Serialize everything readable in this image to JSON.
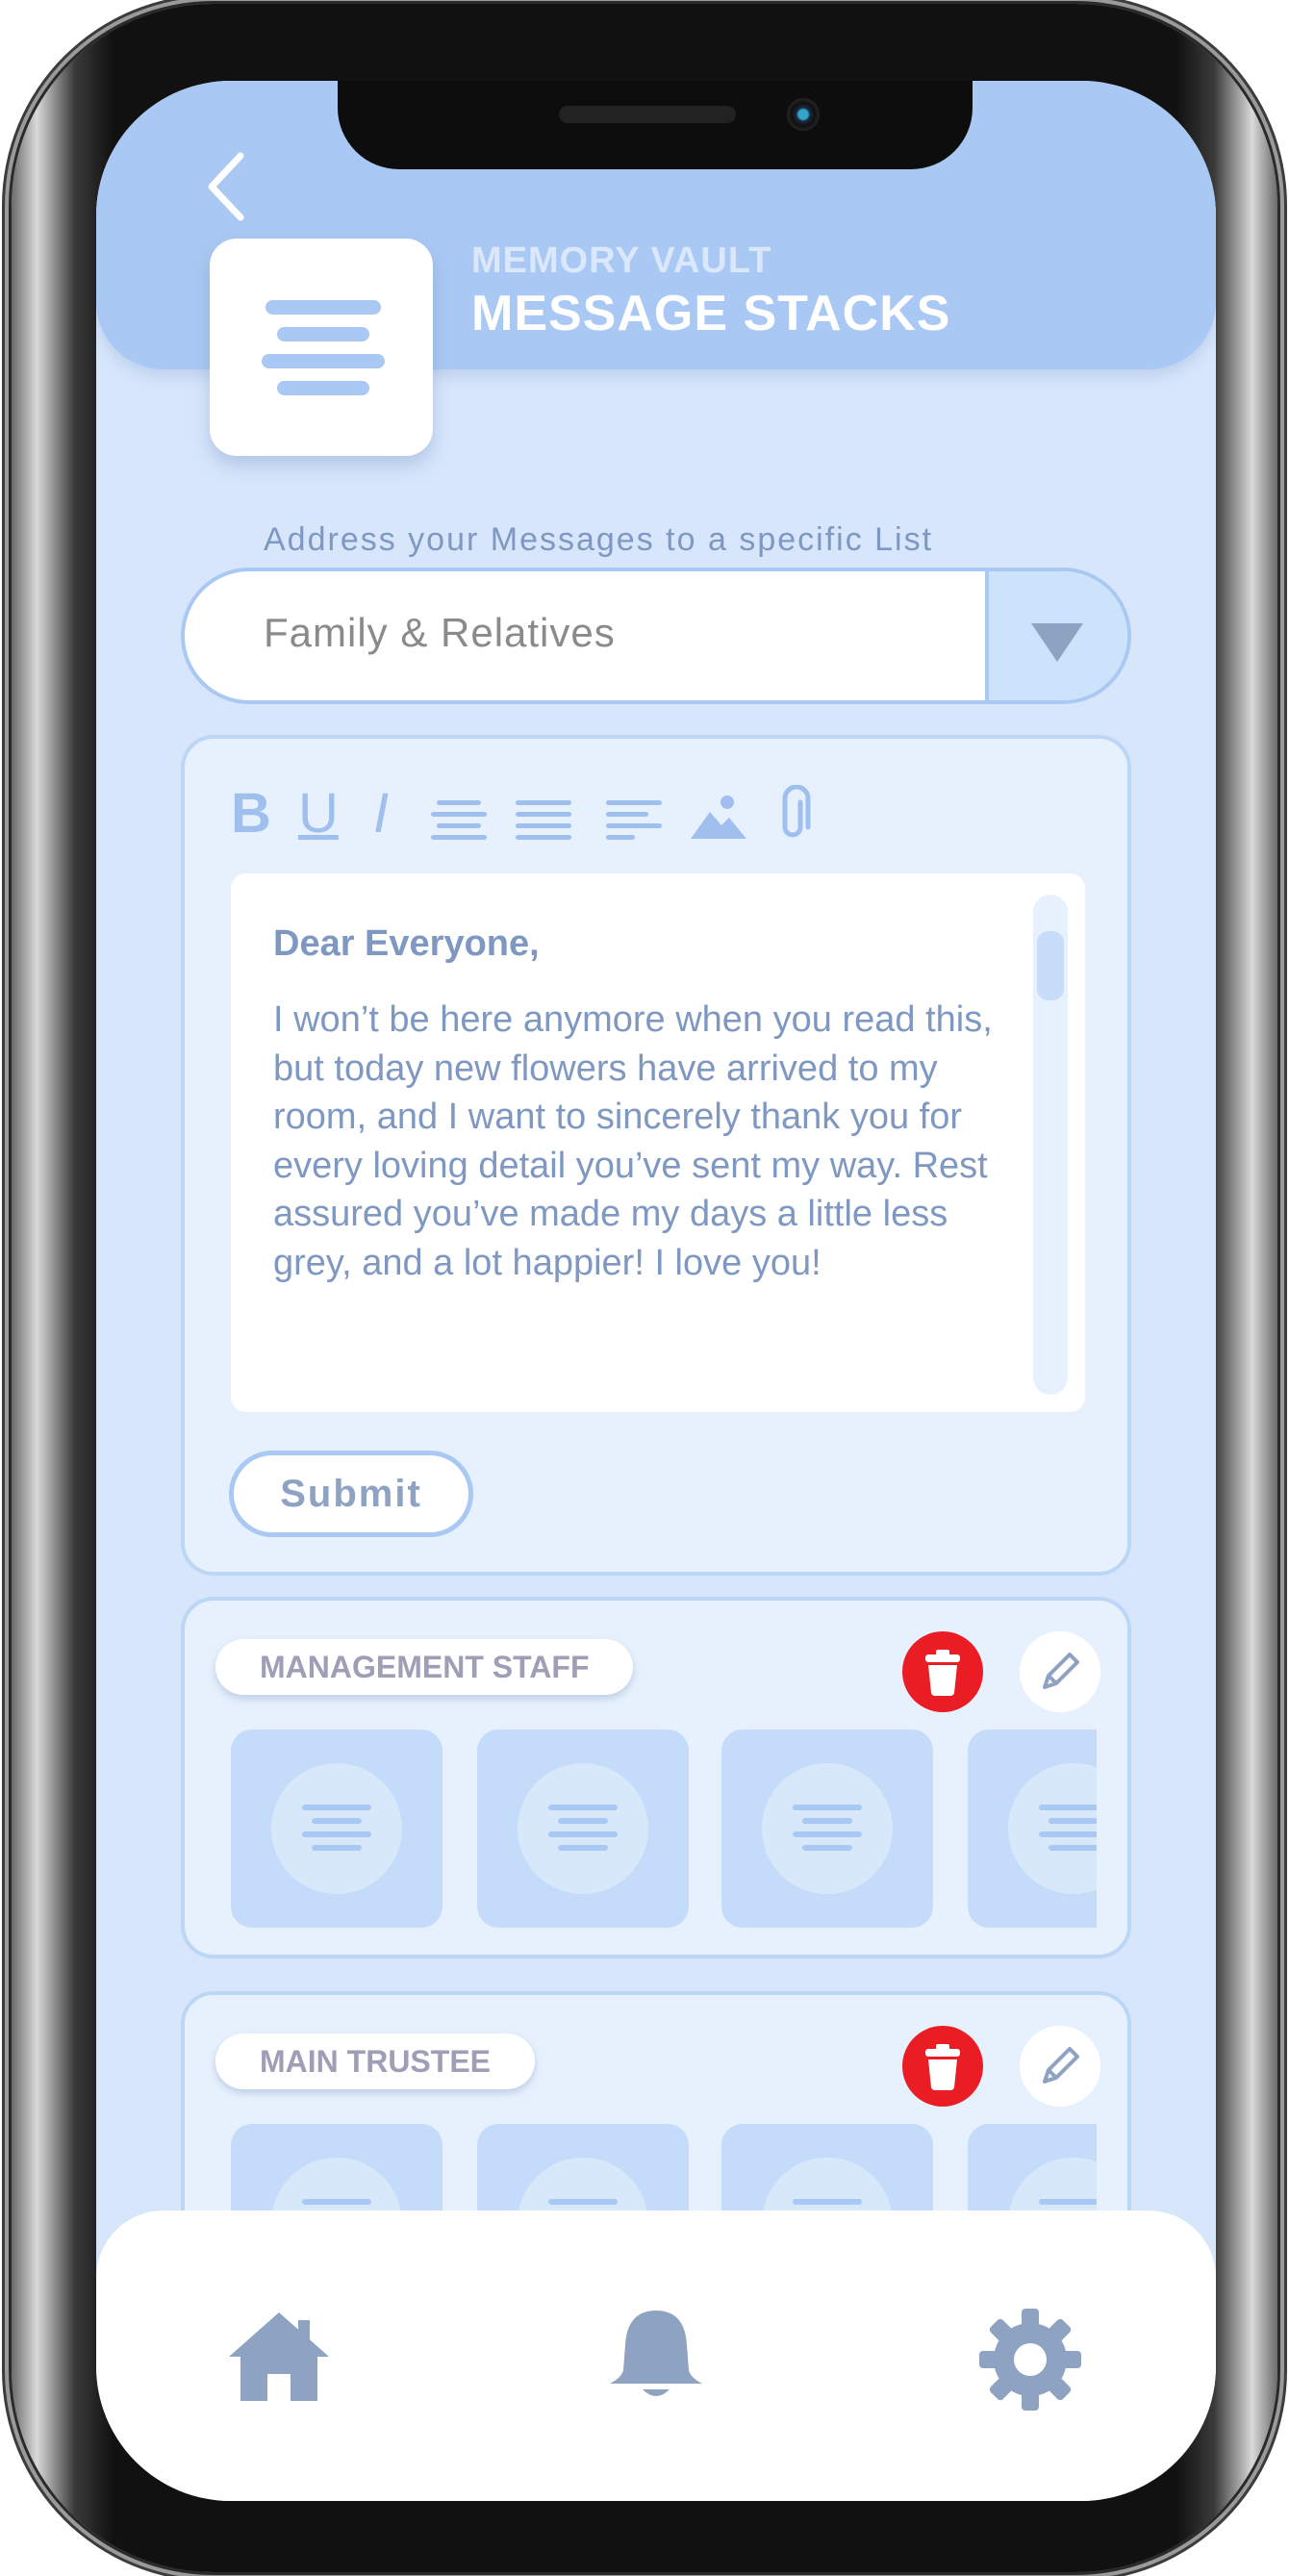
{
  "header": {
    "subtitle": "MEMORY VAULT",
    "title": "MESSAGE STACKS"
  },
  "address": {
    "label": "Address your Messages to a specific List",
    "selected": "Family & Relatives"
  },
  "editor": {
    "toolbar": {
      "bold": "B",
      "underline": "U",
      "italic": "I"
    },
    "greeting": "Dear Everyone,",
    "body": "I won’t be here anymore when you read this, but today new flowers have arrived to my room, and I want to sincerely thank you for every loving detail you’ve sent my way. Rest assured you’ve made my days a little less grey, and a lot happier! I love you!",
    "submit_label": "Submit"
  },
  "stacks": [
    {
      "label": "MANAGEMENT STAFF"
    },
    {
      "label": "MAIN TRUSTEE"
    }
  ],
  "colors": {
    "background": "#d7e6fb",
    "header": "#a9c8f3",
    "accent_text": "#7f98c2",
    "delete": "#ea1c24",
    "icon": "#8ea2c2"
  },
  "icons": {
    "back": "chevron-left-icon",
    "menu": "menu-lines-icon",
    "dropdown": "triangle-down-icon",
    "delete": "trash-icon",
    "edit": "pencil-icon",
    "nav": [
      "home-icon",
      "bell-icon",
      "gear-icon"
    ]
  }
}
